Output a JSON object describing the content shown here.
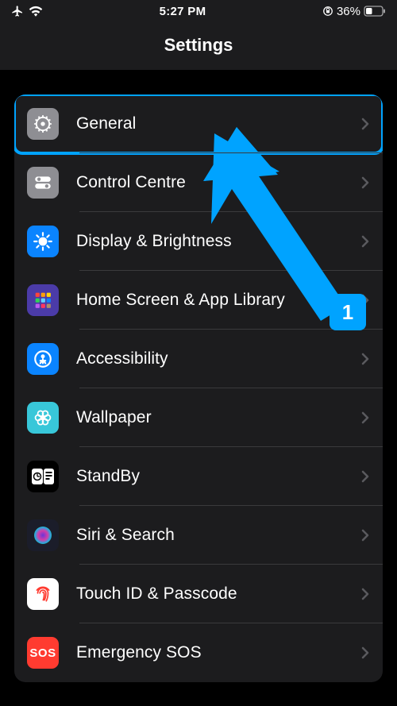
{
  "status": {
    "time": "5:27 PM",
    "battery": "36%"
  },
  "header": {
    "title": "Settings"
  },
  "rows": [
    {
      "name": "general",
      "label": "General",
      "bg": "#8e8e93",
      "icon": "gear"
    },
    {
      "name": "control-centre",
      "label": "Control Centre",
      "bg": "#8e8e93",
      "icon": "toggles"
    },
    {
      "name": "display",
      "label": "Display & Brightness",
      "bg": "#0a84ff",
      "icon": "sun"
    },
    {
      "name": "home-screen",
      "label": "Home Screen & App Library",
      "bg": "#4b3ba8",
      "icon": "grid"
    },
    {
      "name": "accessibility",
      "label": "Accessibility",
      "bg": "#0a84ff",
      "icon": "person"
    },
    {
      "name": "wallpaper",
      "label": "Wallpaper",
      "bg": "#38c7d9",
      "icon": "flower"
    },
    {
      "name": "standby",
      "label": "StandBy",
      "bg": "#000000",
      "icon": "standby"
    },
    {
      "name": "siri",
      "label": "Siri & Search",
      "bg": "#1b1d2a",
      "icon": "siri"
    },
    {
      "name": "touchid",
      "label": "Touch ID & Passcode",
      "bg": "#ffffff",
      "icon": "fingerprint"
    },
    {
      "name": "sos",
      "label": "Emergency SOS",
      "bg": "#ff3b30",
      "icon": "sos"
    }
  ],
  "annotation": {
    "badge": "1",
    "color": "#00a3ff"
  }
}
